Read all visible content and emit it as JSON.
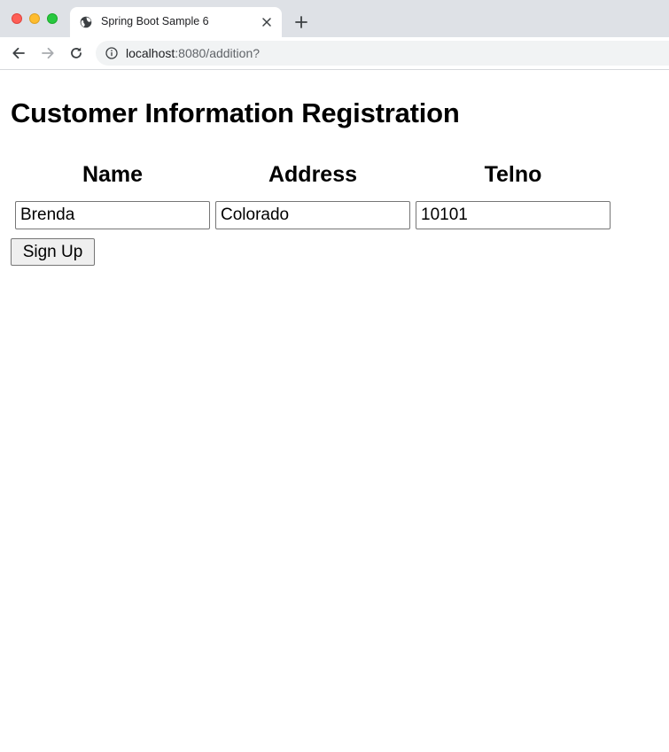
{
  "browser": {
    "tab_title": "Spring Boot Sample 6",
    "url_host": "localhost",
    "url_rest": ":8080/addition?"
  },
  "page": {
    "title": "Customer Information Registration",
    "columns": [
      "Name",
      "Address",
      "Telno"
    ],
    "fields": {
      "name": "Brenda",
      "address": "Colorado",
      "telno": "10101"
    },
    "submit_label": "Sign Up"
  },
  "icons": {
    "tab_favicon": "globe-icon",
    "tab_close": "close-icon",
    "new_tab": "plus-icon",
    "back": "arrow-left-icon",
    "forward": "arrow-right-icon",
    "reload": "reload-icon",
    "site_info": "info-icon"
  },
  "colors": {
    "tabbar_bg": "#dee1e6",
    "omnibox_bg": "#f1f3f4",
    "close_red": "#fe5f57",
    "minimize_yellow": "#febc2e",
    "maximize_green": "#28c840"
  }
}
